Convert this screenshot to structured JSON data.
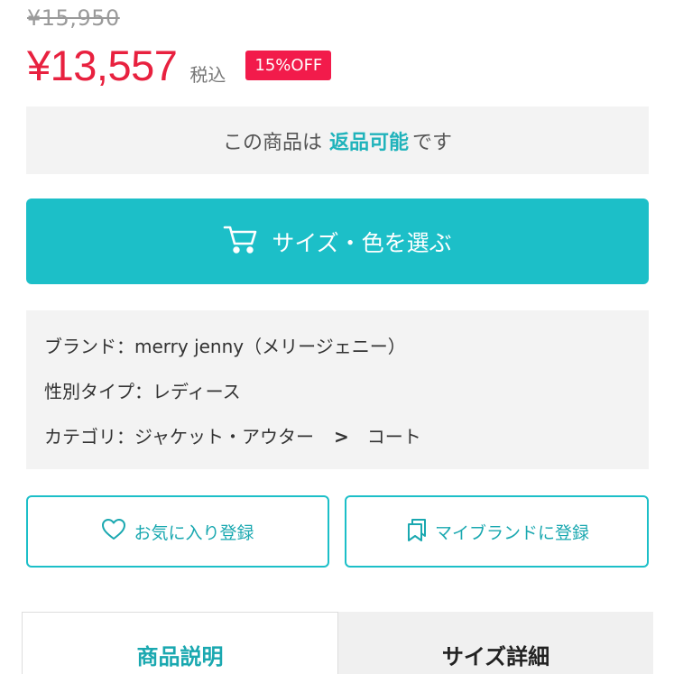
{
  "price": {
    "original": "¥15,950",
    "current": "¥13,557",
    "tax_label": "税込",
    "discount_badge": "15%OFF"
  },
  "return_policy": {
    "prefix": "この商品は",
    "highlight": "返品可能",
    "suffix": "です"
  },
  "cart_button": {
    "label": "サイズ・色を選ぶ",
    "icon": "cart-icon"
  },
  "info": {
    "brand_label": "ブランド：",
    "brand_value": "merry jenny（メリージェニー）",
    "gender_label": "性別タイプ：",
    "gender_value": "レディース",
    "category_label": "カテゴリ：",
    "category_value": "ジャケット・アウター",
    "category_separator": ">",
    "subcategory_value": "コート"
  },
  "actions": {
    "favorite_label": "お気に入り登録",
    "favorite_icon": "heart-icon",
    "my_brand_label": "マイブランドに登録",
    "my_brand_icon": "bookmark-icon"
  },
  "tabs": [
    {
      "label": "商品説明",
      "active": true
    },
    {
      "label": "サイズ詳細",
      "active": false
    }
  ],
  "colors": {
    "accent": "#1cbfc8",
    "price_red": "#e8213f",
    "badge_red": "#f21b4b"
  }
}
